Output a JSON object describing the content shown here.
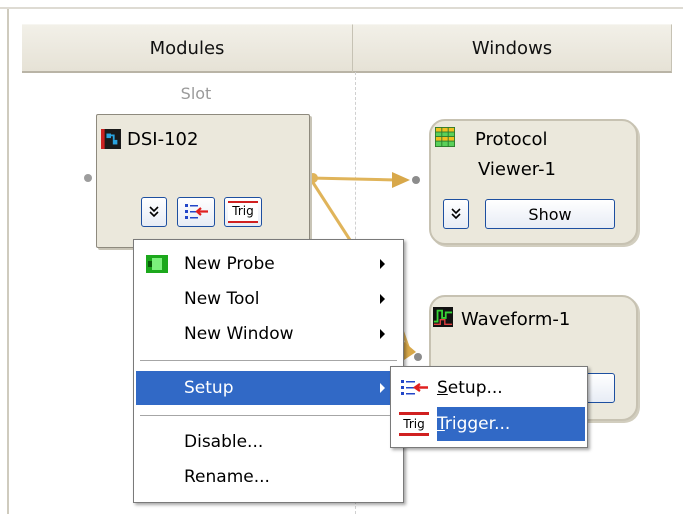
{
  "columns": {
    "modules": "Modules",
    "windows": "Windows"
  },
  "slot_label": "Slot",
  "modules": {
    "dsi": {
      "title": "DSI-102",
      "trig_label": "Trig"
    },
    "protocol_viewer": {
      "title_line1": "Protocol",
      "title_line2": "Viewer-1",
      "show_label": "Show"
    },
    "waveform": {
      "title": "Waveform-1"
    }
  },
  "context_menu": {
    "items": [
      {
        "label": "New Probe",
        "submenu": true
      },
      {
        "label": "New Tool",
        "submenu": true
      },
      {
        "label": "New Window",
        "submenu": true
      },
      {
        "label": "Setup",
        "submenu": true,
        "selected": true
      },
      {
        "label": "Disable...",
        "submenu": false
      },
      {
        "label": "Rename...",
        "submenu": false
      }
    ]
  },
  "setup_submenu": {
    "items": [
      {
        "accel": "S",
        "rest": "etup...",
        "icon": "setup-list-icon"
      },
      {
        "accel": "T",
        "rest": "rigger...",
        "icon": "trig-icon",
        "selected": true
      }
    ]
  },
  "colors": {
    "menu_highlight": "#3169c6",
    "connector": "#e0b45a",
    "button_border": "#1d4fa0"
  }
}
